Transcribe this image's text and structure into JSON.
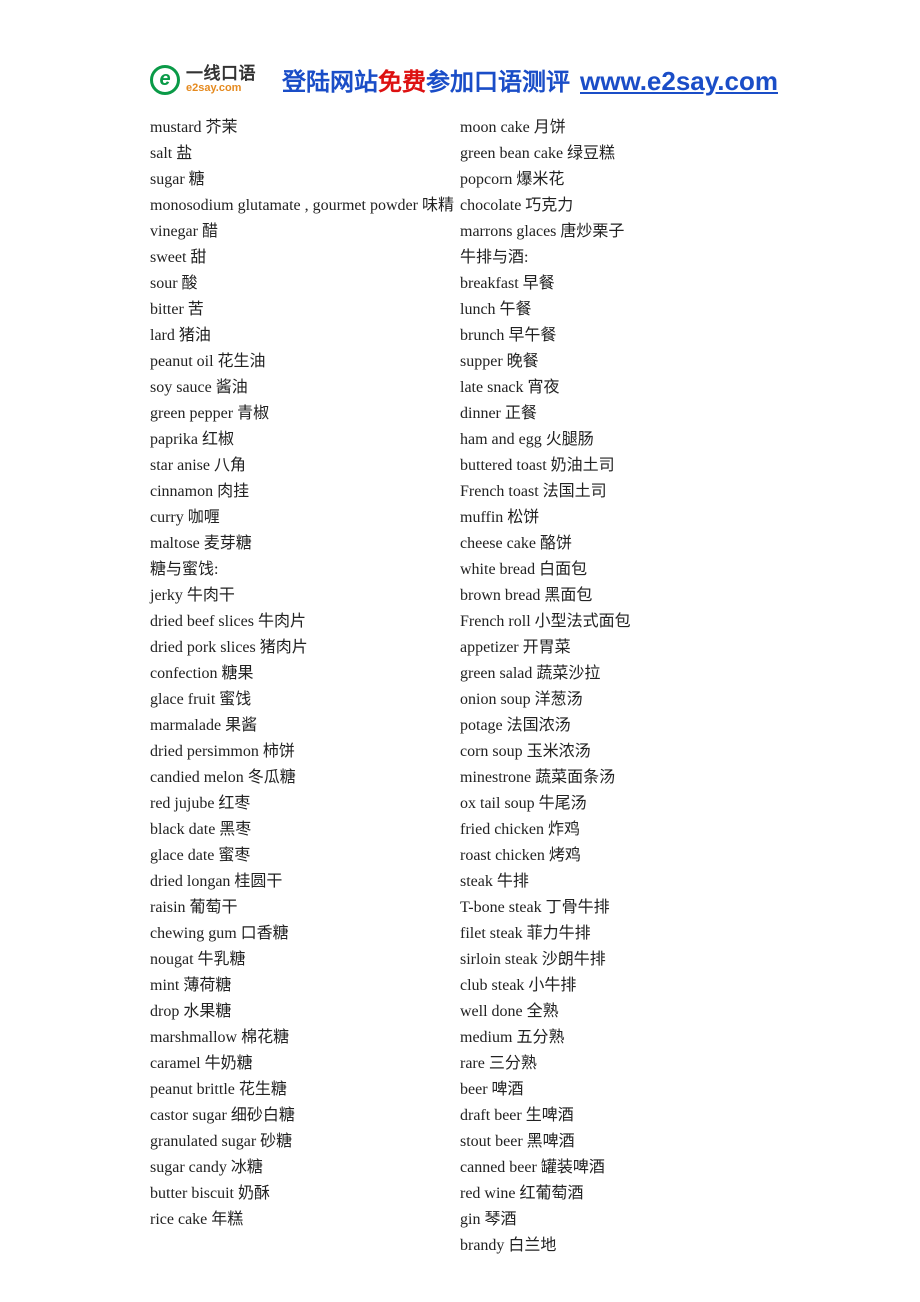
{
  "logo": {
    "mark_letter": "e",
    "cn": "一线口语",
    "en": "e2say.com"
  },
  "banner": {
    "seg1": "登陆网站",
    "seg2": "免费",
    "seg3": "参加口语测评",
    "url": "www.e2say.com"
  },
  "columns": {
    "left": [
      "mustard 芥茉",
      "salt 盐",
      "sugar 糖",
      "monosodium glutamate , gourmet powder 味精",
      "vinegar 醋",
      "sweet 甜",
      "sour 酸",
      "bitter 苦",
      "lard 猪油",
      "peanut oil 花生油",
      "soy sauce 酱油",
      "green pepper 青椒",
      "paprika 红椒",
      "star anise 八角",
      "cinnamon 肉挂",
      "curry 咖喱",
      "maltose 麦芽糖",
      "糖与蜜饯:",
      "jerky 牛肉干",
      "dried beef slices 牛肉片",
      "dried pork slices 猪肉片",
      "confection 糖果",
      "glace fruit 蜜饯",
      "marmalade 果酱",
      "dried persimmon 柿饼",
      "candied melon 冬瓜糖",
      "red jujube 红枣",
      "black date 黑枣",
      "glace date 蜜枣",
      "dried longan 桂圆干",
      "raisin 葡萄干",
      "chewing gum 口香糖",
      "nougat 牛乳糖",
      "mint 薄荷糖",
      "drop 水果糖",
      "marshmallow 棉花糖",
      "caramel 牛奶糖",
      "peanut brittle 花生糖",
      "castor sugar 细砂白糖",
      "granulated sugar 砂糖",
      "sugar candy 冰糖",
      "butter biscuit 奶酥",
      "rice cake 年糕"
    ],
    "right": [
      "moon cake 月饼",
      "green bean cake 绿豆糕",
      "popcorn 爆米花",
      "chocolate 巧克力",
      "marrons glaces 唐炒栗子",
      "牛排与酒:",
      "breakfast 早餐",
      "lunch 午餐",
      "brunch 早午餐",
      "supper 晚餐",
      "late snack 宵夜",
      "dinner 正餐",
      "ham and egg 火腿肠",
      "buttered toast 奶油土司",
      "French toast 法国土司",
      "muffin 松饼",
      "cheese cake 酪饼",
      "white bread 白面包",
      "brown bread 黑面包",
      "French roll 小型法式面包",
      "appetizer 开胃菜",
      "green salad 蔬菜沙拉",
      "onion soup 洋葱汤",
      "potage 法国浓汤",
      "corn soup 玉米浓汤",
      "minestrone 蔬菜面条汤",
      "ox tail soup 牛尾汤",
      "fried chicken 炸鸡",
      "roast chicken 烤鸡",
      "steak 牛排",
      "T-bone steak 丁骨牛排",
      "filet steak 菲力牛排",
      "sirloin steak 沙朗牛排",
      "club steak 小牛排",
      "well done 全熟",
      "medium 五分熟",
      "rare 三分熟",
      "beer 啤酒",
      "draft beer 生啤酒",
      "stout beer 黑啤酒",
      "canned beer 罐装啤酒",
      "red wine 红葡萄酒",
      "gin 琴酒",
      "brandy 白兰地"
    ]
  }
}
